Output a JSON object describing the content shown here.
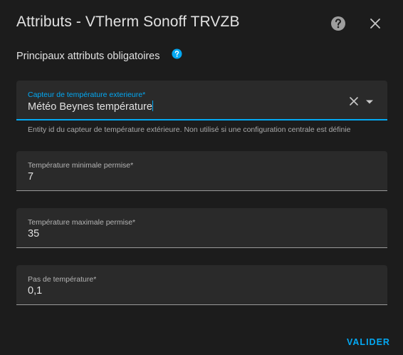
{
  "dialog": {
    "title": "Attributs - VTherm Sonoff TRVZB",
    "section_title": "Principaux attributs obligatoires",
    "submit_label": "VALIDER"
  },
  "fields": {
    "outdoor_sensor": {
      "label": "Capteur de température exterieure*",
      "value": "Météo Beynes température",
      "helper": "Entity id du capteur de température extérieure. Non utilisé si une configuration centrale est définie"
    },
    "min_temp": {
      "label": "Température minimale permise*",
      "value": "7"
    },
    "max_temp": {
      "label": "Température maximale permise*",
      "value": "35"
    },
    "temp_step": {
      "label": "Pas de température*",
      "value": "0,1"
    }
  },
  "colors": {
    "accent": "#03a9f4",
    "background": "#1c1c1c",
    "field_background": "#2a2a2a",
    "text_primary": "#e1e1e1",
    "text_secondary": "#a9a9a9"
  },
  "icons": {
    "help": "help-circle-icon",
    "close": "close-icon",
    "info": "info-icon",
    "clear": "clear-icon",
    "dropdown": "chevron-down-icon"
  }
}
